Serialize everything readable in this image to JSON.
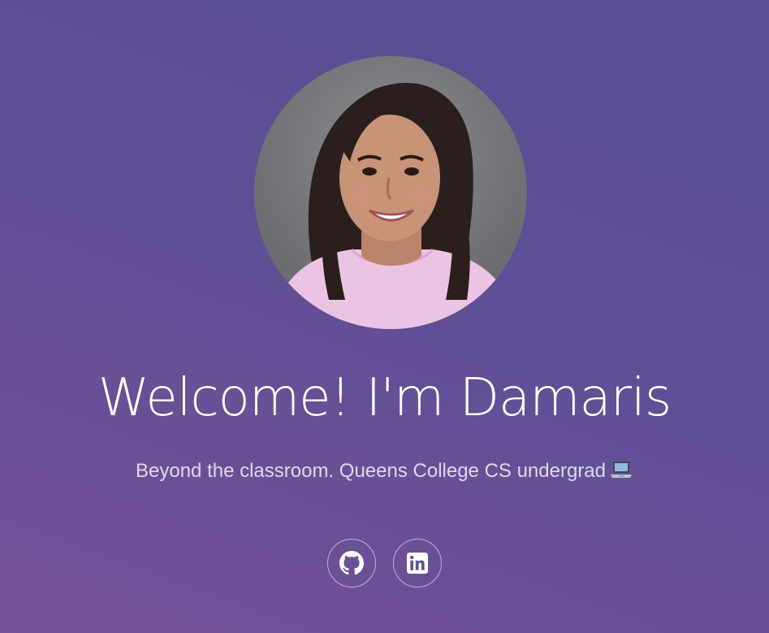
{
  "hero": {
    "avatar_alt": "Portrait of Damaris",
    "title": "Welcome! I'm Damaris",
    "subtitle": "Beyond the classroom. Queens College CS undergrad",
    "subtitle_emoji": "laptop-icon"
  },
  "socials": [
    {
      "name": "GitHub",
      "icon": "github-icon"
    },
    {
      "name": "LinkedIn",
      "icon": "linkedin-icon"
    }
  ],
  "colors": {
    "background_top": "#5a4e92",
    "background_bottom": "#755196",
    "text": "#ffffff",
    "sweater": "#e9c2e3",
    "hair": "#2a1f1c"
  }
}
